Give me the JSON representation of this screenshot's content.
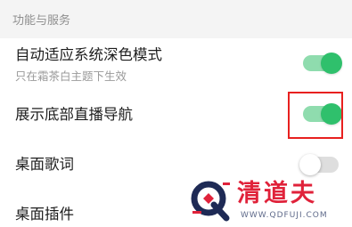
{
  "section": {
    "title": "功能与服务"
  },
  "rows": [
    {
      "title": "自动适应系统深色模式",
      "subtitle": "只在霜茶白主题下生效",
      "toggle_on": true
    },
    {
      "title": "展示底部直播导航",
      "toggle_on": true
    },
    {
      "title": "桌面歌词",
      "toggle_on": false
    },
    {
      "title": "桌面插件"
    }
  ],
  "colors": {
    "toggle_on_track": "#8fdcae",
    "toggle_on_knob": "#2fc06c",
    "highlight": "#e8201f",
    "watermark_red": "#e0223a"
  },
  "watermark": {
    "brand": "清道夫",
    "url": "WWW.QDFUJI.COM",
    "icon": "q-logo-icon"
  }
}
